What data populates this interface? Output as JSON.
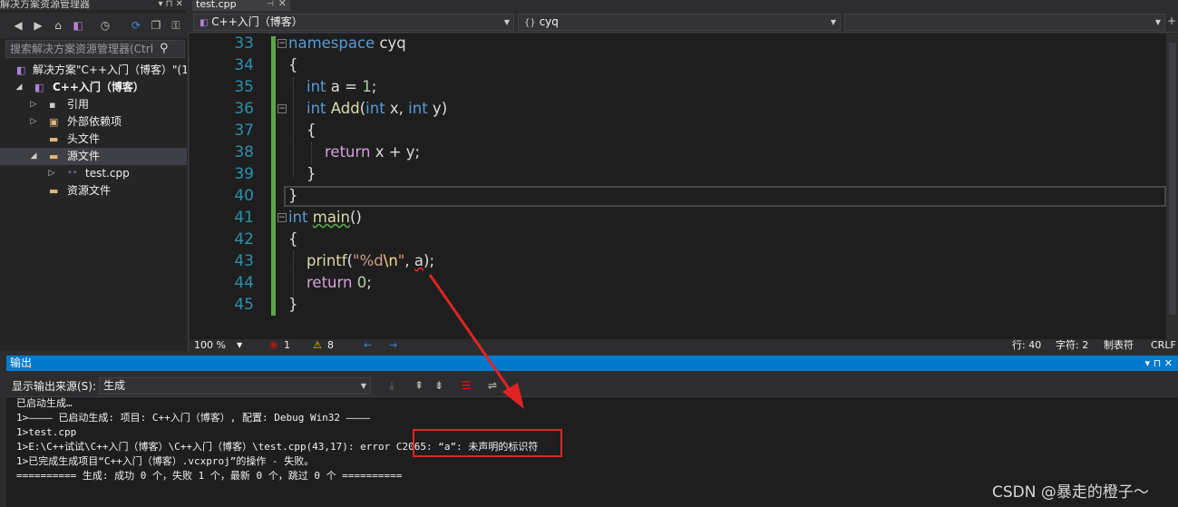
{
  "solution_explorer": {
    "title": "解决方案资源管理器",
    "title_buttons": "▾ ⊓ ✕",
    "search_placeholder": "搜索解决方案资源管理器(Ctrl",
    "tree": [
      {
        "label": "解决方案\"C++入门（博客）\"(1",
        "level": 0,
        "expander": "",
        "icon": "solution-icon"
      },
      {
        "label": "C++入门（博客）",
        "level": 0,
        "expander": "◢",
        "icon": "project-icon",
        "bold": true
      },
      {
        "label": "引用",
        "level": 1,
        "expander": "▷",
        "icon": "references-icon"
      },
      {
        "label": "外部依赖项",
        "level": 1,
        "expander": "▷",
        "icon": "external-deps-icon"
      },
      {
        "label": "头文件",
        "level": 1,
        "expander": "",
        "icon": "folder-icon"
      },
      {
        "label": "源文件",
        "level": 1,
        "expander": "◢",
        "icon": "folder-open-icon",
        "selected": true
      },
      {
        "label": "test.cpp",
        "level": 2,
        "expander": "▷",
        "icon": "cpp-file-icon"
      },
      {
        "label": "资源文件",
        "level": 1,
        "expander": "",
        "icon": "folder-icon"
      }
    ]
  },
  "editor": {
    "tab_label": "test.cpp",
    "tab_pin": "⊣",
    "tab_close": "✕",
    "nav_project": "C++入门（博客）",
    "nav_scope": "cyq",
    "nav_member": "",
    "line_numbers": [
      "33",
      "34",
      "35",
      "36",
      "37",
      "38",
      "39",
      "40",
      "41",
      "42",
      "43",
      "44",
      "45"
    ],
    "zoom": "100 %",
    "errors": "1",
    "warnings": "8",
    "status_line": "行: 40",
    "status_char": "字符: 2",
    "status_mode": "制表符",
    "status_eol": "CRLF"
  },
  "code_tokens": {
    "l33": [
      "namespace",
      " cyq"
    ],
    "l34": [
      "{"
    ],
    "l35": [
      "int",
      " a = ",
      "1",
      ";"
    ],
    "l36": [
      "int",
      " ",
      "Add",
      "(",
      "int",
      " x, ",
      "int",
      " y)"
    ],
    "l37": [
      "{"
    ],
    "l38": [
      "return",
      " x + y;"
    ],
    "l39": [
      "}"
    ],
    "l40": [
      "}"
    ],
    "l41": [
      "int",
      " ",
      "main",
      "()"
    ],
    "l42": [
      "{"
    ],
    "l43": [
      "printf",
      "(",
      "\"%d",
      "\\n",
      "\"",
      ", ",
      "a",
      ");"
    ],
    "l44": [
      "return",
      " ",
      "0",
      ";"
    ],
    "l45": [
      "}"
    ]
  },
  "output": {
    "title": "输出",
    "title_buttons": "▾ ⊓ ✕",
    "source_label": "显示输出来源(S):",
    "source_value": "生成",
    "lines": [
      "已启动生成…",
      "1>———— 已启动生成: 项目: C++入门（博客）, 配置: Debug Win32 ————",
      "1>test.cpp",
      "1>E:\\C++试试\\C++入门（博客）\\C++入门（博客）\\test.cpp(43,17): error C2065: “a”: 未声明的标识符",
      "1>已完成生成项目“C++入门（博客）.vcxproj”的操作 - 失败。",
      "========== 生成: 成功 0 个，失败 1 个，最新 0 个，跳过 0 个 =========="
    ]
  },
  "watermark": "CSDN @暴走的橙子～",
  "colors": {
    "accent": "#007acc",
    "annotation_red": "#e02424",
    "keyword": "#569cd6",
    "function": "#dcdcaa",
    "line_number": "#2b91af",
    "change_bar": "#57a64a"
  }
}
